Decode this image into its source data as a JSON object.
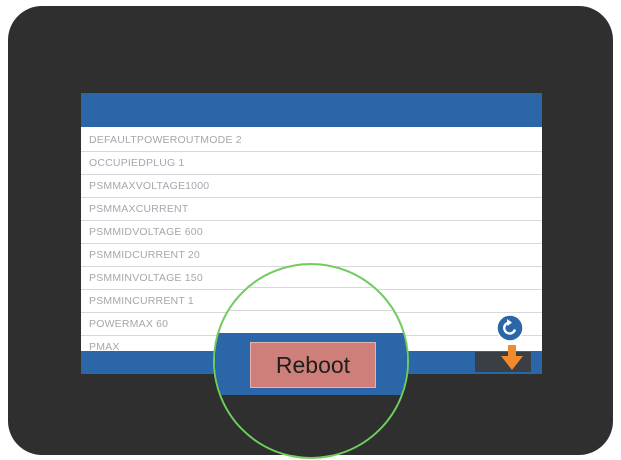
{
  "list": {
    "rows": [
      "DEFAULTPOWEROUTMODE 2",
      "OCCUPIEDPLUG 1",
      "PSMMAXVOLTAGE1000",
      "PSMMAXCURRENT",
      "PSMMIDVOLTAGE 600",
      "PSMMIDCURRENT 20",
      "PSMMINVOLTAGE 150",
      "PSMMINCURRENT 1",
      "POWERMAX 60",
      "PMAX"
    ]
  },
  "buttons": {
    "reboot_label": "Reboot"
  },
  "icons": {
    "refresh": "refresh-icon",
    "download": "arrow-down-icon"
  },
  "colors": {
    "bar": "#2a66a8",
    "reboot": "#cf7f79",
    "highlight_ring": "#6fcf5c",
    "arrow": "#f08a2b"
  }
}
